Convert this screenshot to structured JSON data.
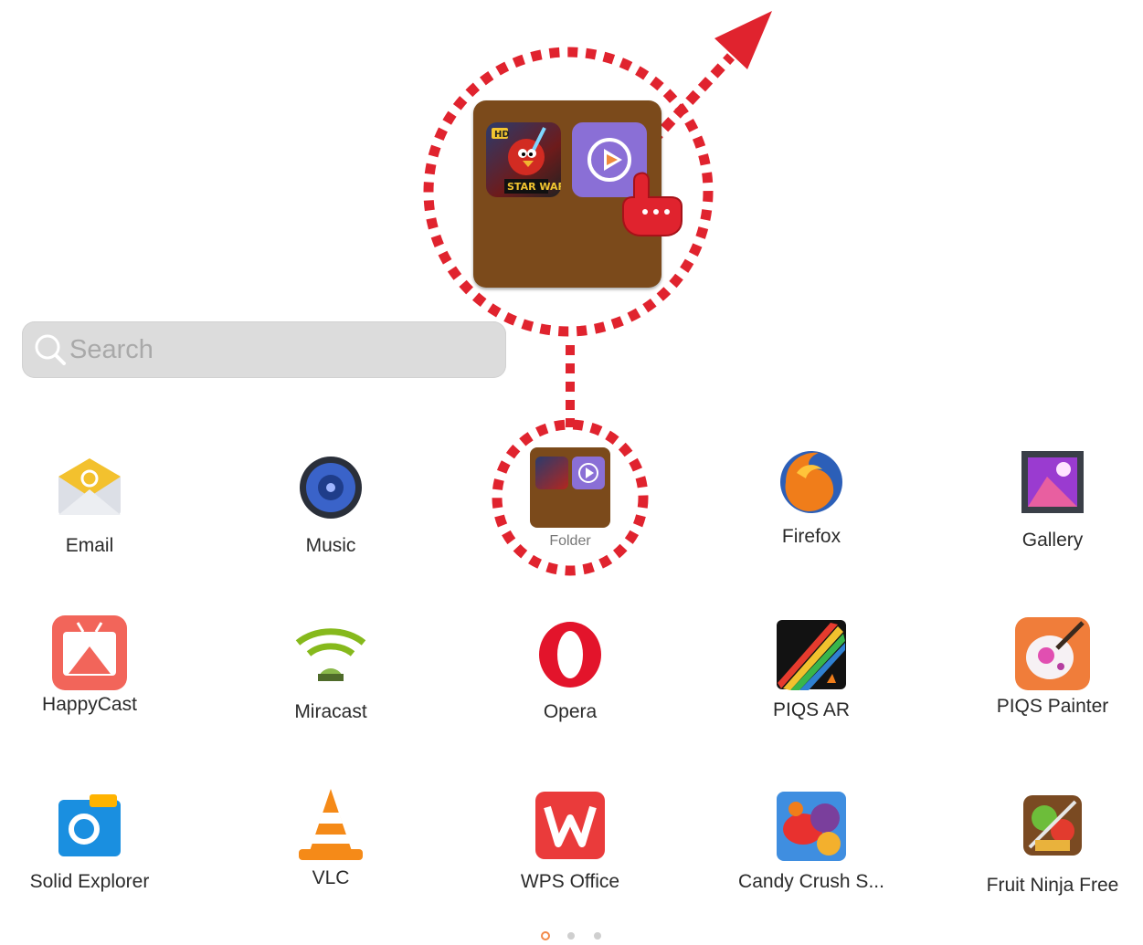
{
  "search": {
    "placeholder": "Search",
    "icon": "search-icon"
  },
  "folder_large": {
    "icons": [
      "angry-birds-star-wars-icon",
      "video-player-icon"
    ]
  },
  "apps": [
    {
      "label": "Email",
      "icon": "email-icon"
    },
    {
      "label": "Music",
      "icon": "music-icon"
    },
    {
      "label": "Folder",
      "icon": "folder-icon"
    },
    {
      "label": "Firefox",
      "icon": "firefox-icon"
    },
    {
      "label": "Gallery",
      "icon": "gallery-icon"
    },
    {
      "label": "HappyCast",
      "icon": "happycast-icon"
    },
    {
      "label": "Miracast",
      "icon": "miracast-icon"
    },
    {
      "label": "Opera",
      "icon": "opera-icon"
    },
    {
      "label": "PIQS AR",
      "icon": "piqs-ar-icon"
    },
    {
      "label": "PIQS Painter",
      "icon": "piqs-painter-icon"
    },
    {
      "label": "Solid Explorer",
      "icon": "solid-explorer-icon"
    },
    {
      "label": "VLC",
      "icon": "vlc-icon"
    },
    {
      "label": "WPS Office",
      "icon": "wps-office-icon"
    },
    {
      "label": "Candy Crush S...",
      "icon": "candy-crush-icon"
    },
    {
      "label": "Fruit Ninja Free",
      "icon": "fruit-ninja-icon"
    }
  ],
  "pager": {
    "pages": 3,
    "current": 1
  },
  "colors": {
    "annotation": "#e0232e",
    "folder": "#7b4a1b",
    "pager_active": "#f28a4a"
  }
}
